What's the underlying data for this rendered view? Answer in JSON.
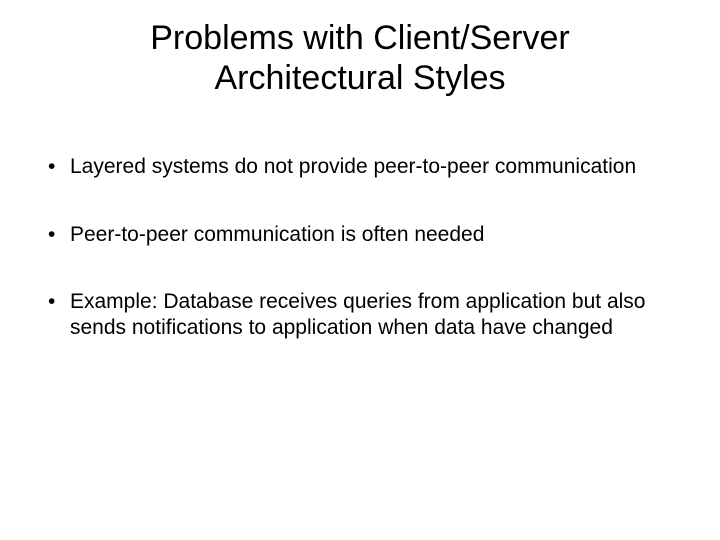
{
  "title": "Problems with Client/Server Architectural Styles",
  "bullets": [
    "Layered systems do not provide peer-to-peer communication",
    "Peer-to-peer communication is often needed",
    "Example: Database receives queries  from application but also sends notifications to application when data have changed"
  ]
}
